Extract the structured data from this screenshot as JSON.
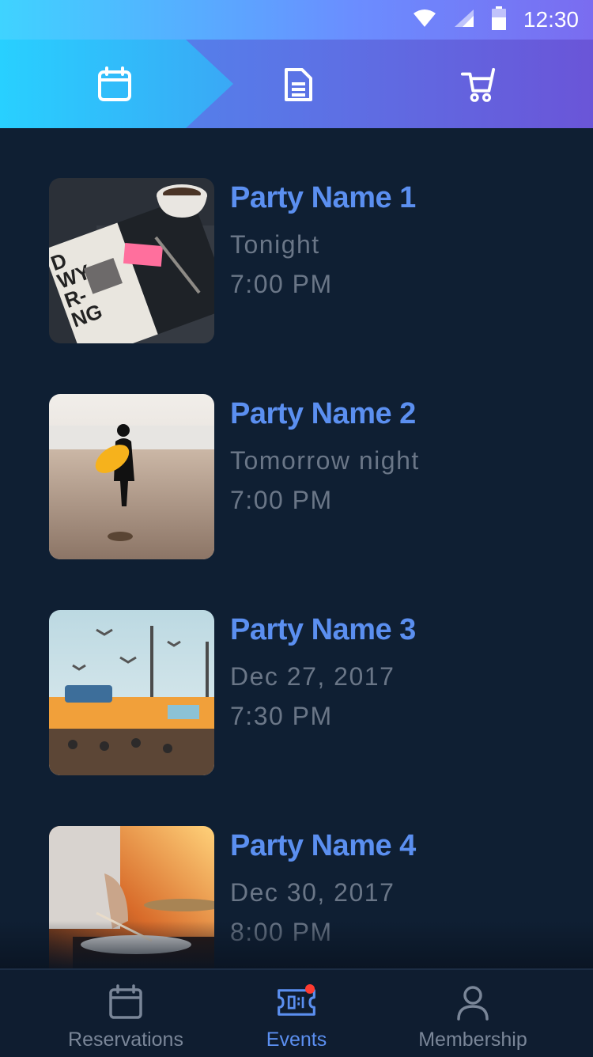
{
  "status_bar": {
    "time": "12:30"
  },
  "top_nav": {
    "tabs": [
      {
        "icon": "calendar-icon",
        "active": true
      },
      {
        "icon": "document-icon",
        "active": false
      },
      {
        "icon": "cart-icon",
        "active": false
      }
    ]
  },
  "events": [
    {
      "title": "Party Name 1",
      "date": "Tonight",
      "time": "7:00 PM",
      "image": "desk-notebook-coffee-photo"
    },
    {
      "title": "Party Name 2",
      "date": "Tomorrow night",
      "time": "7:00 PM",
      "image": "surfer-beach-photo"
    },
    {
      "title": "Party Name 3",
      "date": "Dec 27, 2017",
      "time": "7:30 PM",
      "image": "seagulls-pier-photo"
    },
    {
      "title": "Party Name 4",
      "date": "Dec 30, 2017",
      "time": "8:00 PM",
      "image": "drummer-sunset-photo"
    }
  ],
  "bottom_tabs": [
    {
      "label": "Reservations",
      "icon": "calendar-icon",
      "active": false
    },
    {
      "label": "Events",
      "icon": "ticket-icon",
      "active": true,
      "has_notification": true
    },
    {
      "label": "Membership",
      "icon": "user-icon",
      "active": false
    }
  ],
  "colors": {
    "accent": "#5b8ff0",
    "background": "#0f1f33",
    "muted_text": "#6a7687",
    "notification": "#ff3b30"
  }
}
